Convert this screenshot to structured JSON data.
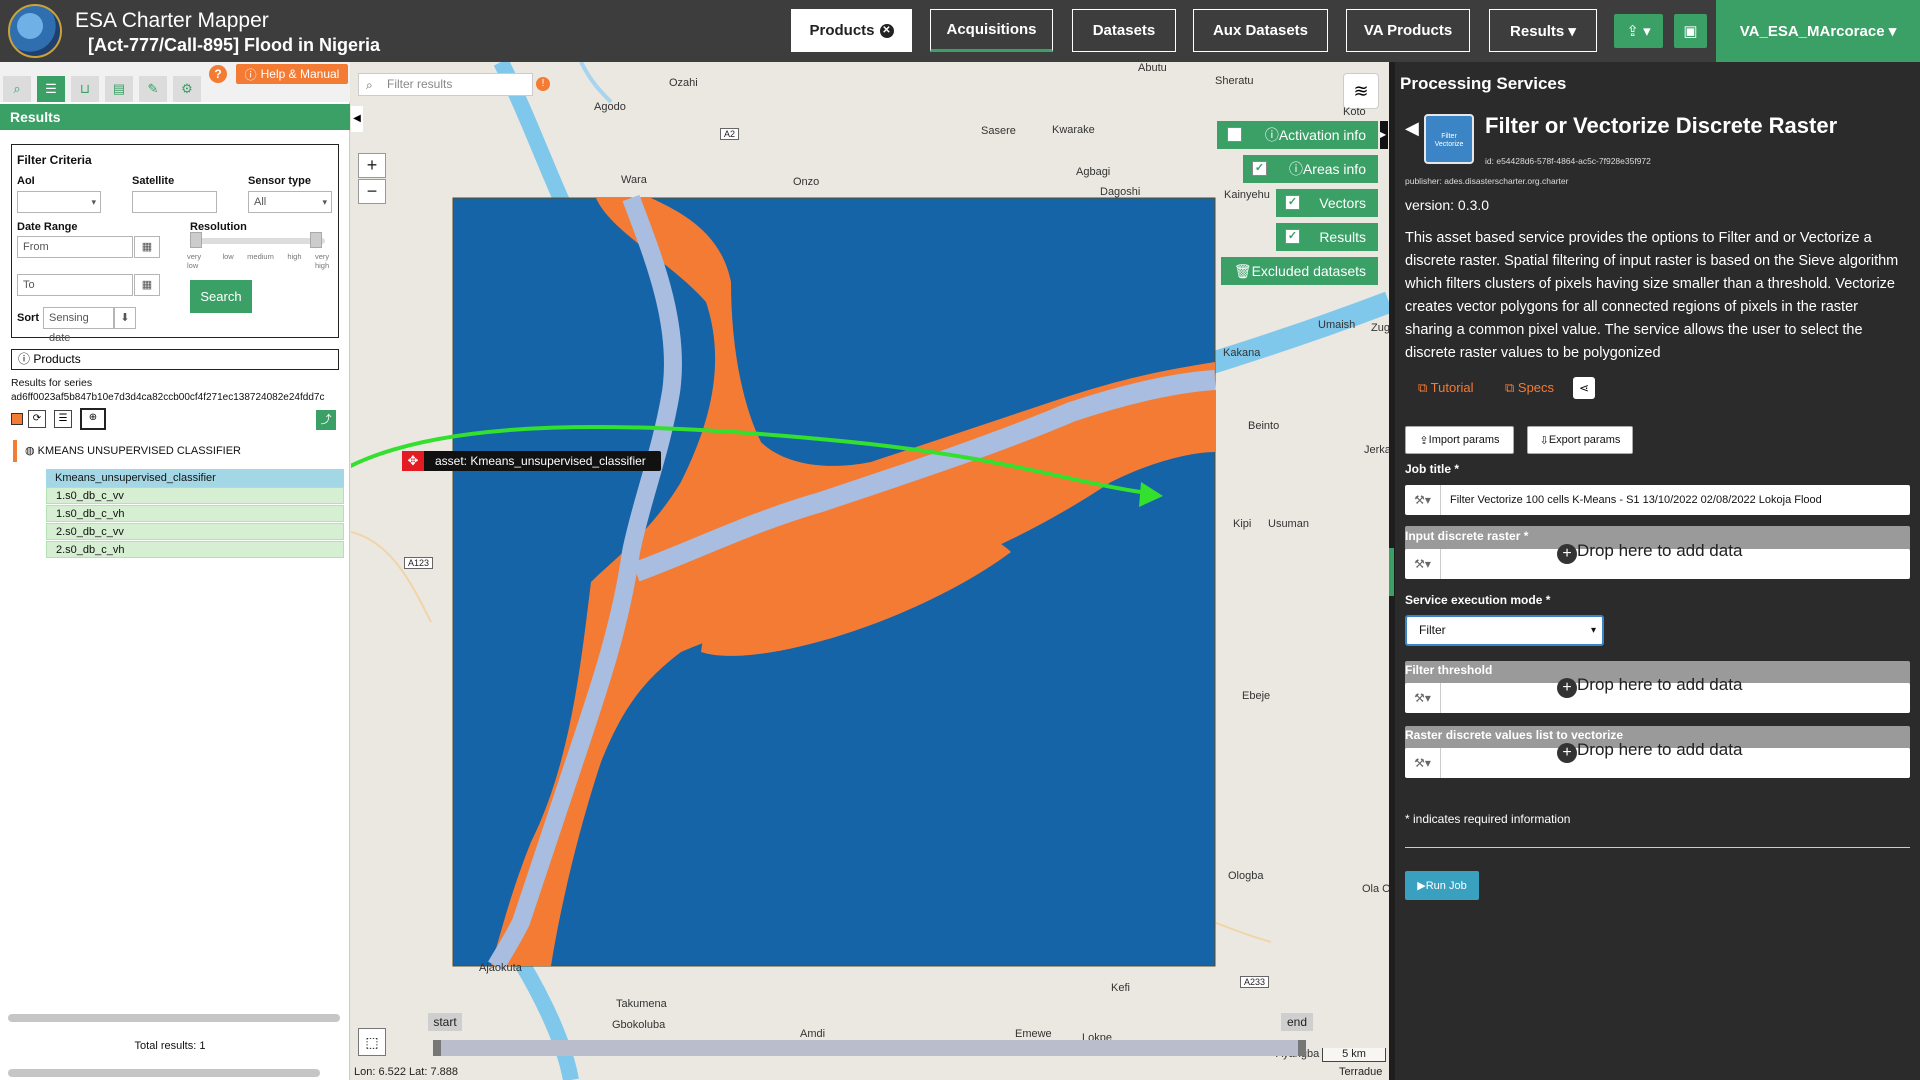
{
  "header": {
    "app_title": "ESA Charter Mapper",
    "activation": "[Act-777/Call-895] Flood in Nigeria",
    "nav": {
      "products": "Products",
      "acquisitions": "Acquisitions",
      "datasets": "Datasets",
      "aux_datasets": "Aux Datasets",
      "va_products": "VA Products",
      "results": "Results ▾"
    },
    "user": "VA_ESA_MArcorace ▾"
  },
  "left": {
    "help_label": "Help & Manual",
    "results_label": "Results",
    "filter": {
      "title": "Filter Criteria",
      "aoi_label": "AoI",
      "satellite_label": "Satellite",
      "sensor_type_label": "Sensor type",
      "sensor_type_value": "All",
      "date_range_label": "Date Range",
      "from_placeholder": "From",
      "to_placeholder": "To",
      "resolution_label": "Resolution",
      "resolution_ticks": [
        "very low",
        "low",
        "medium",
        "high",
        "very high"
      ],
      "sort_label": "Sort",
      "sort_value": "Sensing date",
      "search_label": "Search"
    },
    "products_label": "Products",
    "results_for_series": "Results for series",
    "series_id": "ad6ff0023af5b847b10e7d3d4ca82ccb00cf4f271ec138724082e24fdd7c",
    "classifier_label": "KMEANS UNSUPERVISED CLASSIFIER",
    "selected_product": "Kmeans_unsupervised_classifier",
    "products": [
      "1.s0_db_c_vv",
      "1.s0_db_c_vh",
      "2.s0_db_c_vv",
      "2.s0_db_c_vh"
    ],
    "total_results": "Total results: 1"
  },
  "map": {
    "filter_placeholder": "Filter results",
    "layers": {
      "activation_info": "Activation info",
      "areas_info": "Areas info",
      "vectors": "Vectors",
      "results": "Results",
      "excluded": "Excluded datasets"
    },
    "asset_tag": "asset: Kmeans_unsupervised_classifier",
    "places": {
      "ozahi": "Ozahi",
      "agodo": "Agodo",
      "wara": "Wara",
      "onzo": "Onzo",
      "abutu": "Abutu",
      "sheratu": "Sheratu",
      "koto": "Koto",
      "sasere": "Sasere",
      "kwarake": "Kwarake",
      "agbagi": "Agbagi",
      "dagoshi": "Dagoshi",
      "kainyehu": "Kainyehu",
      "umaish": "Umaish",
      "zug": "Zug",
      "kakana": "Kakana",
      "beinto": "Beinto",
      "jerka": "Jerka",
      "kipi": "Kipi",
      "usuman": "Usuman",
      "ebeje": "Ebeje",
      "ologba": "Ologba",
      "olaog": "Ola Og",
      "ajaokuta": "Ajaokuta",
      "kefi": "Kefi",
      "takumena": "Takumena",
      "gbokoluba": "Gbokoluba",
      "amdi": "Amdi",
      "emewe": "Emewe",
      "lokpe": "Lokpe",
      "ayangba": "Ayangba"
    },
    "roads": {
      "a2": "A2",
      "a123": "A123",
      "a233": "A233"
    },
    "timeline_start": "start",
    "timeline_end": "end",
    "coords": "Lon: 6.522 Lat: 7.888",
    "scale": "5 km",
    "attribution": "Terradue",
    "colors": {
      "water": "#1564a8",
      "flood": "#f47b34",
      "river": "#a8bddf",
      "basemap": "#ebe8e1"
    }
  },
  "right": {
    "title": "Processing Services",
    "service_icon_text": "Filter Vectorize",
    "service_name": "Filter or Vectorize Discrete Raster",
    "service_id": "id: e54428d6-578f-4864-ac5c-7f928e35f972",
    "publisher": "publisher: ades.disasterscharter.org.charter",
    "version": "version: 0.3.0",
    "description": "This asset based service provides the options to Filter and or Vectorize a discrete raster. Spatial filtering of input raster is based on the Sieve algorithm which filters clusters of pixels having size smaller than a threshold. Vectorize creates vector polygons for all connected regions of pixels in the raster sharing a common pixel value. The service allows the user to select the discrete raster values to be polygonized",
    "tutorial": "Tutorial",
    "specs": "Specs",
    "import_params": "Import params",
    "export_params": "Export params",
    "job_title_label": "Job title *",
    "job_title_value": "Filter Vectorize 100 cells K-Means - S1 13/10/2022 02/08/2022 Lokoja Flood",
    "input_raster_label": "Input discrete raster *",
    "drop_text": "Drop here to add data",
    "exec_mode_label": "Service execution mode *",
    "exec_mode_value": "Filter",
    "filter_threshold_label": "Filter threshold",
    "raster_values_label": "Raster discrete values list to vectorize",
    "required_note": "* indicates required information",
    "run_job": "Run Job"
  }
}
